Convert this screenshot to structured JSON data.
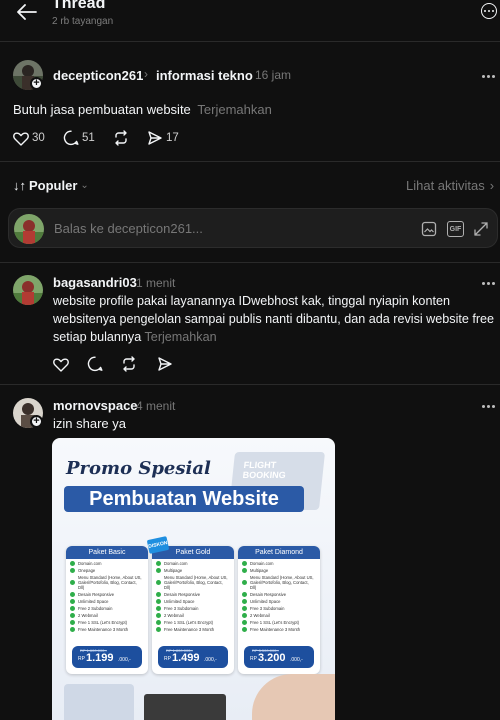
{
  "header": {
    "title": "Thread",
    "subtitle": "2 rb tayangan"
  },
  "post": {
    "username": "decepticon261",
    "community": "informasi tekno",
    "time": "16 jam",
    "text": "Butuh jasa pembuatan website",
    "translate": "Terjemahkan",
    "likes": "30",
    "replies": "51",
    "shares": "17"
  },
  "sort": {
    "label": "Populer",
    "activity": "Lihat aktivitas"
  },
  "reply_box": {
    "placeholder": "Balas ke decepticon261..."
  },
  "replies": [
    {
      "username": "bagasandri03",
      "time": "1 menit",
      "line1": "website profile pakai layanannya IDwebhost kak, tinggal nyiapin konten",
      "line2": "websitenya pengelolan sampai publis nanti dibantu, dan ada revisi website free",
      "line3": "setiap bulannya",
      "translate": "Terjemahkan"
    },
    {
      "username": "mornovspace",
      "time": "4 menit",
      "text": "izin share ya"
    }
  ],
  "promo": {
    "script_title": "Promo Spesial",
    "main_title": "Pembuatan Website",
    "screen_label_1": "FLIGHT",
    "screen_label_2": "BOOKING",
    "badge": "DISKON",
    "packages": [
      {
        "name": "Paket Basic",
        "features": [
          "Domain.com",
          "Onepage",
          "Menu Standard (Home, About US, Galeri/Portofolio, Blog, Contact, Dll)",
          "Desain Responsive",
          "Unlimited Space",
          "Free 2 Subdomain",
          "2 Webmail",
          "Free 1 SSL (Let's Encrypt)",
          "Free Maintenance 3 Month"
        ],
        "old_price": "RP 1.600.000,-",
        "currency": "RP",
        "price": "1.199",
        "suffix": ".000,-"
      },
      {
        "name": "Paket Gold",
        "features": [
          "Domain.com",
          "Multipage",
          "Menu Standard (Home, About US, Galeri/Portofolio, Blog, Contact, Dll)",
          "Desain Responsive",
          "Unlimited Space",
          "Free 3 Subdomain",
          "2 Webmail",
          "Free 1 SSL (Let's Encrypt)",
          "Free Maintenance 3 Month"
        ],
        "old_price": "RP 1.800.000,-",
        "currency": "RP",
        "price": "1.499",
        "suffix": ".000,-"
      },
      {
        "name": "Paket Diamond",
        "features": [
          "Domain.com",
          "Multipage",
          "Menu Standard (Home, About US, Galeri/Portofolio, Blog, Contact, Dll)",
          "Desain Responsive",
          "Unlimited Space",
          "Free 3 Subdomain",
          "2 Webmail",
          "Free 1 SSL (Let's Encrypt)",
          "Free Maintenance 3 Month"
        ],
        "old_price": "RP 3.500.000,-",
        "currency": "RP",
        "price": "3.200",
        "suffix": ".000,-"
      }
    ]
  },
  "colors": {
    "background": "#101010",
    "text": "#f3f5f7",
    "muted": "#777777",
    "promo_blue": "#2b5aa6",
    "promo_check": "#2fae4a"
  }
}
